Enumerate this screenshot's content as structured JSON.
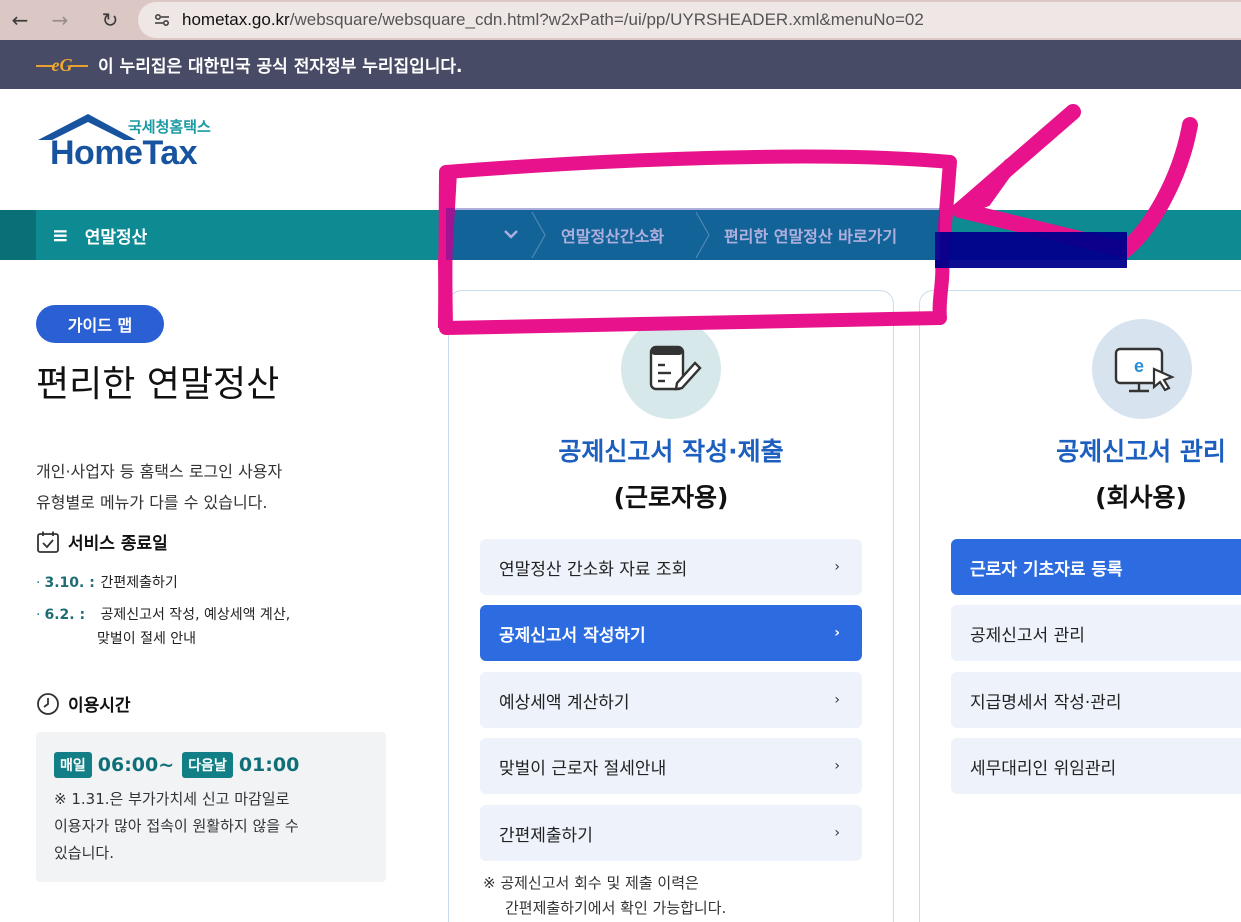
{
  "browser": {
    "url_host": "hometax.go.kr",
    "url_path": "/websquare/websquare_cdn.html?w2xPath=/ui/pp/UYRSHEADER.xml&menuNo=02",
    "back_icon": "←",
    "forward_icon": "→",
    "reload_icon": "↻"
  },
  "gov_banner": {
    "text": "이 누리집은 대한민국 공식 전자정부 누리집입니다."
  },
  "logo": {
    "sub": "국세청홈택스",
    "main": "HomeTax"
  },
  "menu": {
    "hamburger": "≡",
    "home_label": "연말정산",
    "chevron": "⌄",
    "crumbs": [
      "연말정산간소화",
      "편리한 연말정산 바로가기"
    ]
  },
  "left": {
    "guide_pill": "가이드 맵",
    "title": "편리한 연말정산",
    "desc_line1": "개인·사업자 등 홈택스 로그인 사용자",
    "desc_line2": "유형별로 메뉴가 다를 수 있습니다.",
    "service_end_title": "서비스 종료일",
    "end_items": [
      {
        "date": "3.10. :",
        "text": "간편제출하기",
        "text2": ""
      },
      {
        "date": "6.2. :",
        "text": "공제신고서 작성, 예상세액 계산,",
        "text2": "맞벌이 절세 안내"
      }
    ],
    "hours_title": "이용시간",
    "tag_daily": "매일",
    "time_start": "06:00~",
    "tag_next": "다음날",
    "time_end": "01:00",
    "hours_note_1": "※ 1.31.은 부가가치세 신고 마감일로",
    "hours_note_2": "이용자가 많아 접속이 원활하지 않을 수",
    "hours_note_3": "있습니다."
  },
  "card_employee": {
    "title": "공제신고서 작성·제출",
    "subtitle": "(근로자용)",
    "items": [
      {
        "label": "연말정산 간소화 자료 조회",
        "active": false
      },
      {
        "label": "공제신고서 작성하기",
        "active": true
      },
      {
        "label": "예상세액 계산하기",
        "active": false
      },
      {
        "label": "맞벌이 근로자 절세안내",
        "active": false
      },
      {
        "label": "간편제출하기",
        "active": false
      }
    ],
    "arrow": "›",
    "note_1": "※ 공제신고서 회수 및 제출 이력은",
    "note_2": "간편제출하기에서 확인 가능합니다."
  },
  "card_company": {
    "title": "공제신고서 관리",
    "subtitle": "(회사용)",
    "items": [
      {
        "label": "근로자 기초자료 등록",
        "active": true
      },
      {
        "label": "공제신고서 관리",
        "active": false
      },
      {
        "label": "지급명세서 작성·관리",
        "active": false
      },
      {
        "label": "세무대리인 위임관리",
        "active": false
      }
    ]
  },
  "colors": {
    "teal_menu": "#0e8a93",
    "primary_blue": "#2c6be0",
    "title_blue": "#1c5fbf",
    "annotation_magenta": "#e8128c",
    "annotation_navy": "#00008b"
  }
}
